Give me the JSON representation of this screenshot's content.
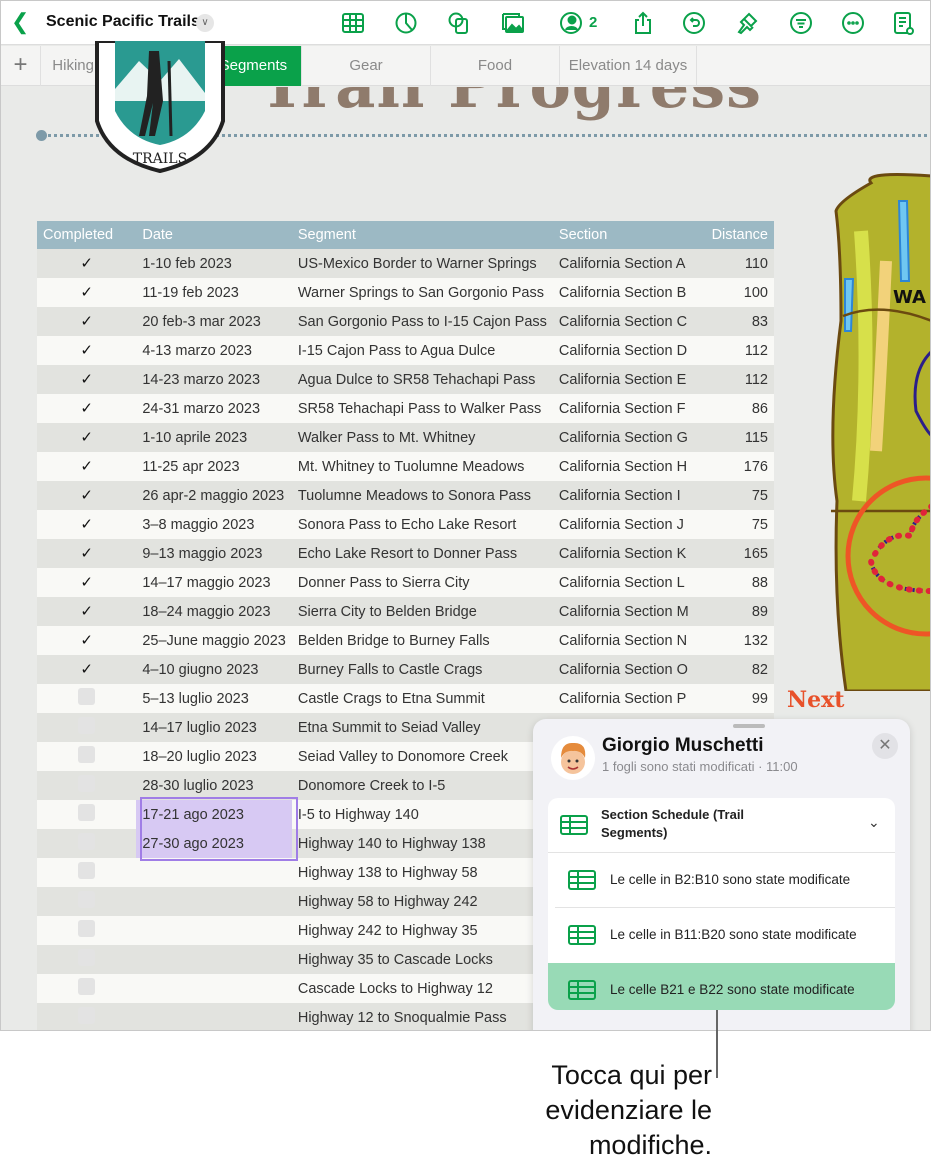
{
  "toolbar": {
    "title": "Scenic Pacific Trails",
    "collaborators_count": "2",
    "icons": [
      "back-icon",
      "table-icon",
      "chart-icon",
      "shape-icon",
      "media-icon",
      "collaborate-icon",
      "share-icon",
      "undo-icon",
      "format-brush-icon",
      "organize-icon",
      "more-icon",
      "document-icon"
    ]
  },
  "tabs": {
    "add": "+",
    "items": [
      "Hiking Schedule",
      "Trail Segments",
      "Gear",
      "Food",
      "Elevation 14 days"
    ],
    "active": "Trail Segments"
  },
  "sheet": {
    "heading": "Trail Progress",
    "logo_text": "SCENIC PACIFIC TRAILS",
    "next_label": "Next",
    "map_label": "WA"
  },
  "table": {
    "headers": [
      "Completed",
      "Date",
      "Segment",
      "Section",
      "Distance"
    ],
    "rows": [
      {
        "done": true,
        "date": "1-10 feb 2023",
        "segment": "US-Mexico Border to Warner Springs",
        "section": "California Section A",
        "distance": "110"
      },
      {
        "done": true,
        "date": "11-19 feb 2023",
        "segment": "Warner Springs to San Gorgonio Pass",
        "section": "California Section B",
        "distance": "100"
      },
      {
        "done": true,
        "date": "20 feb-3 mar 2023",
        "segment": "San Gorgonio Pass to I-15 Cajon Pass",
        "section": "California Section C",
        "distance": "83"
      },
      {
        "done": true,
        "date": "4-13 marzo 2023",
        "segment": "I-15 Cajon Pass to Agua Dulce",
        "section": "California Section D",
        "distance": "112"
      },
      {
        "done": true,
        "date": "14-23 marzo 2023",
        "segment": "Agua Dulce to SR58 Tehachapi Pass",
        "section": "California Section E",
        "distance": "112"
      },
      {
        "done": true,
        "date": "24-31 marzo 2023",
        "segment": "SR58 Tehachapi Pass to Walker Pass",
        "section": "California Section F",
        "distance": "86"
      },
      {
        "done": true,
        "date": "1-10 aprile 2023",
        "segment": "Walker Pass to Mt. Whitney",
        "section": "California Section G",
        "distance": "115"
      },
      {
        "done": true,
        "date": "11-25 apr 2023",
        "segment": "Mt. Whitney to Tuolumne Meadows",
        "section": "California Section H",
        "distance": "176"
      },
      {
        "done": true,
        "date": "26 apr-2 maggio 2023",
        "segment": "Tuolumne Meadows to Sonora Pass",
        "section": "California Section I",
        "distance": "75"
      },
      {
        "done": true,
        "date": "3–8 maggio 2023",
        "segment": "Sonora Pass to Echo Lake Resort",
        "section": "California Section J",
        "distance": "75"
      },
      {
        "done": true,
        "date": "9–13 maggio 2023",
        "segment": "Echo Lake Resort to Donner Pass",
        "section": "California Section K",
        "distance": "165"
      },
      {
        "done": true,
        "date": "14–17 maggio 2023",
        "segment": "Donner Pass to Sierra City",
        "section": "California Section L",
        "distance": "88"
      },
      {
        "done": true,
        "date": "18–24 maggio 2023",
        "segment": "Sierra City to Belden Bridge",
        "section": "California Section M",
        "distance": "89"
      },
      {
        "done": true,
        "date": "25–June maggio 2023",
        "segment": "Belden Bridge to Burney Falls",
        "section": "California Section N",
        "distance": "132"
      },
      {
        "done": true,
        "date": "4–10 giugno 2023",
        "segment": "Burney Falls to Castle Crags",
        "section": "California Section O",
        "distance": "82"
      },
      {
        "done": false,
        "date": "5–13 luglio 2023",
        "segment": "Castle Crags to Etna Summit",
        "section": "California Section P",
        "distance": "99"
      },
      {
        "done": false,
        "date": "14–17 luglio 2023",
        "segment": "Etna Summit to Seiad Valley",
        "section": "",
        "distance": ""
      },
      {
        "done": false,
        "date": "18–20 luglio 2023",
        "segment": "Seiad Valley to Donomore Creek",
        "section": "",
        "distance": ""
      },
      {
        "done": false,
        "date": "28-30 luglio 2023",
        "segment": "Donomore Creek to I-5",
        "section": "",
        "distance": ""
      },
      {
        "done": false,
        "date": "17-21 ago 2023",
        "segment": "I-5 to Highway 140",
        "section": "",
        "distance": "",
        "highlight": true
      },
      {
        "done": false,
        "date": "27-30 ago 2023",
        "segment": "Highway 140 to Highway 138",
        "section": "",
        "distance": "",
        "highlight": true
      },
      {
        "done": false,
        "date": "",
        "segment": "Highway 138 to Highway 58",
        "section": "",
        "distance": ""
      },
      {
        "done": false,
        "date": "",
        "segment": "Highway 58 to Highway 242",
        "section": "",
        "distance": ""
      },
      {
        "done": false,
        "date": "",
        "segment": "Highway 242 to Highway 35",
        "section": "",
        "distance": ""
      },
      {
        "done": false,
        "date": "",
        "segment": "Highway 35 to Cascade Locks",
        "section": "",
        "distance": ""
      },
      {
        "done": false,
        "date": "",
        "segment": "Cascade Locks to Highway 12",
        "section": "",
        "distance": ""
      },
      {
        "done": false,
        "date": "",
        "segment": "Highway 12 to Snoqualmie Pass",
        "section": "",
        "distance": ""
      }
    ]
  },
  "activity": {
    "user": "Giorgio Muschetti",
    "summary": "1 fogli sono stati modificati",
    "time": "11:00",
    "group_title": "Section Schedule (Trail Segments)",
    "items": [
      "Le celle in B2:B10 sono state modificate",
      "Le celle in B11:B20 sono state modificate",
      "Le celle B21 e B22 sono state modificate"
    ],
    "highlight_color": "#98dab6"
  },
  "callout": {
    "text": "Tocca qui per evidenziare le modifiche."
  },
  "colors": {
    "accent": "#0aa14a",
    "header": "#9cb9c4",
    "selection": "#a07de6",
    "next": "#e8512a"
  }
}
